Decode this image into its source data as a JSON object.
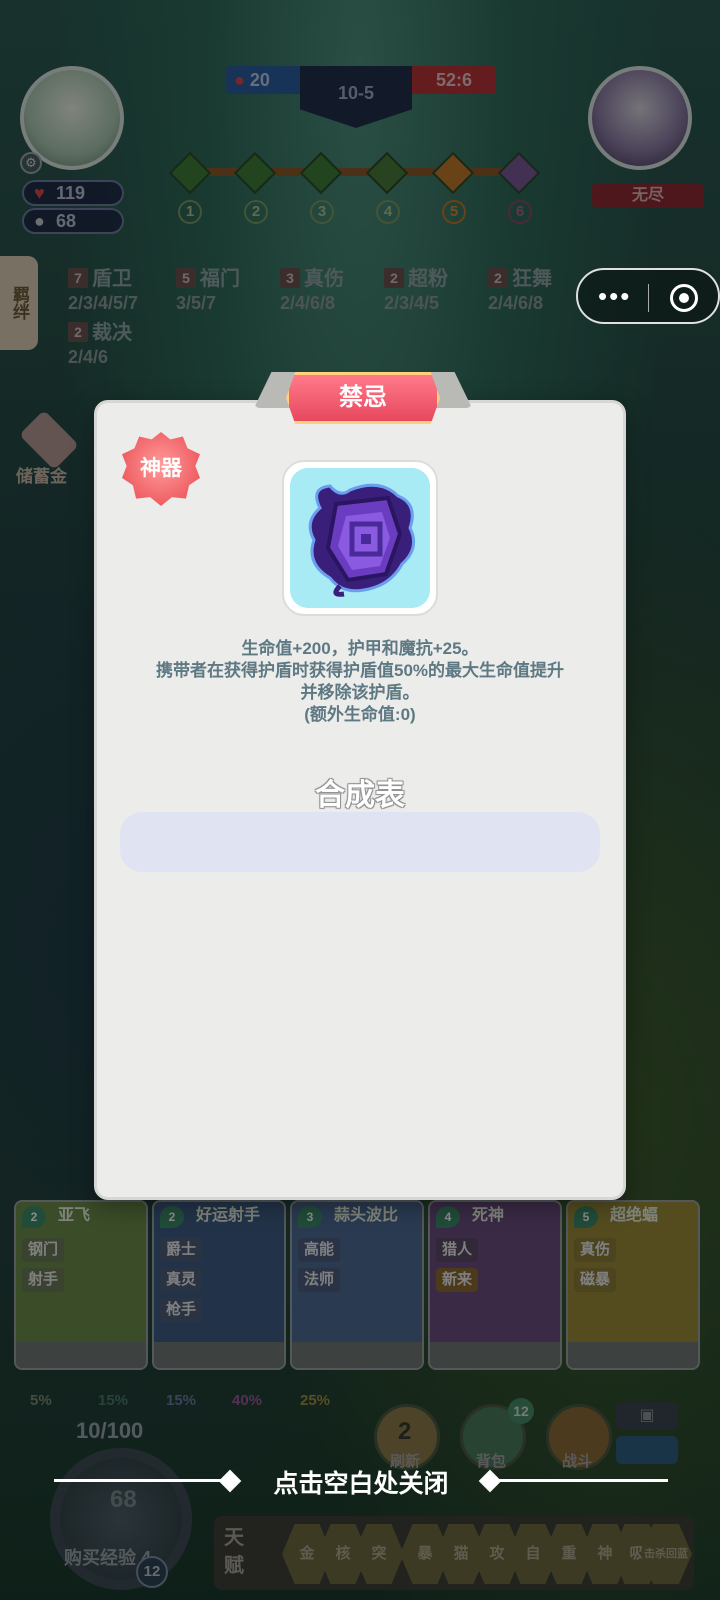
{
  "hud": {
    "player_hp": "119",
    "player_coins": "68",
    "score_left": "20",
    "round": "10-5",
    "score_right": "52:6",
    "enemy_name": "无尽",
    "stages": [
      "1",
      "2",
      "3",
      "4",
      "5",
      "6"
    ],
    "side_tab": "羁绊"
  },
  "synergies": [
    {
      "count": "7",
      "name": "盾卫",
      "levels": "2/3/4/5/7"
    },
    {
      "count": "5",
      "name": "福门",
      "levels": "3/5/7"
    },
    {
      "count": "3",
      "name": "真伤",
      "levels": "2/4/6/8"
    },
    {
      "count": "2",
      "name": "超粉",
      "levels": "2/3/4/5"
    },
    {
      "count": "2",
      "name": "狂舞",
      "levels": "2/4/6/8"
    },
    {
      "count": "2",
      "name": "裁决",
      "levels": "2/4/6"
    }
  ],
  "piggy_label": "储蓄金",
  "modal": {
    "category": "禁忌",
    "badge": "神器",
    "description_lines": [
      "生命值+200，护甲和魔抗+25。",
      "携带者在获得护盾时获得护盾值50%的最大生命值提升",
      "并移除该护盾。",
      "(额外生命值:0)"
    ],
    "recipe_title": "合成表"
  },
  "shop_cards": [
    {
      "name": "亚飞",
      "cost": "2",
      "tags": [
        "钢门",
        "射手"
      ],
      "color": "#6a8a4a"
    },
    {
      "name": "好运射手",
      "cost": "2",
      "tags": [
        "爵士",
        "真灵",
        "枪手"
      ],
      "color": "#3f5e86"
    },
    {
      "name": "蒜头波比",
      "cost": "3",
      "tags": [
        "高能",
        "法师"
      ],
      "color": "#4d6a92"
    },
    {
      "name": "死神",
      "cost": "4",
      "tags": [
        "猎人",
        "新来"
      ],
      "color": "#6b4d7e"
    },
    {
      "name": "超绝蝠",
      "cost": "5",
      "tags": [
        "真伤",
        "磁暴"
      ],
      "color": "#9a8a3a"
    }
  ],
  "odds": [
    "5%",
    "15%",
    "15%",
    "40%",
    "25%"
  ],
  "odds_colors": [
    "#7a8a7a",
    "#4a7a6a",
    "#6a7aa0",
    "#9a5a9a",
    "#a09040"
  ],
  "bottom": {
    "xp_progress": "10/100",
    "coins": "68",
    "buy_xp_label": "购买经验",
    "buy_xp_cost": "4",
    "level": "12",
    "refresh_label": "刷新",
    "refresh_cost": "2",
    "bag_label": "背包",
    "bag_count": "12",
    "battle_label": "战斗",
    "talent_label": "天赋",
    "talents": [
      "金",
      "核",
      "突",
      "暴",
      "猫",
      "攻",
      "自",
      "重",
      "神",
      "吸",
      "击杀回蓝"
    ],
    "close_hint": "点击空白处关闭"
  }
}
